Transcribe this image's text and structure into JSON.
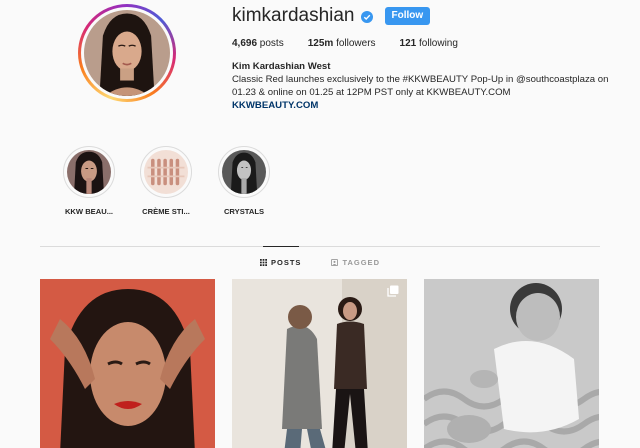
{
  "profile": {
    "username": "kimkardashian",
    "follow_label": "Follow",
    "stats": {
      "posts_count": "4,696",
      "posts_label": " posts",
      "followers_count": "125m",
      "followers_label": " followers",
      "following_count": "121",
      "following_label": " following"
    },
    "bio": {
      "full_name": "Kim Kardashian West",
      "line1": "Classic Red launches exclusively to the #KKWBEAUTY Pop-Up in @southcoastplaza on",
      "line2": "01.23 & online on 01.25 at 12PM PST only at KKWBEAUTY.COM",
      "link": "KKWBEAUTY.COM"
    }
  },
  "highlights": [
    {
      "label": "KKW BEAU..."
    },
    {
      "label": "CRÈME STI..."
    },
    {
      "label": "CRYSTALS"
    }
  ],
  "tabs": [
    {
      "label": "POSTS",
      "icon": "grid-icon",
      "active": true
    },
    {
      "label": "TAGGED",
      "icon": "tag-icon",
      "active": false
    }
  ],
  "colors": {
    "accent": "#3897f0",
    "verified": "#3897f0",
    "link": "#003569"
  }
}
